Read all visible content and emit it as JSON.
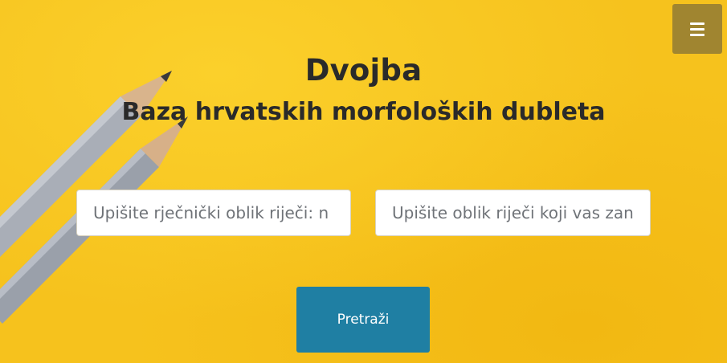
{
  "header": {
    "title": "Dvojba",
    "subtitle": "Baza hrvatskih morfoloških dubleta"
  },
  "menu": {
    "icon": "hamburger-menu-icon"
  },
  "search": {
    "lemma_placeholder": "Upišite rječnički oblik riječi: n",
    "form_placeholder": "Upišite oblik riječi koji vas zan",
    "button_label": "Pretraži"
  },
  "colors": {
    "background": "#f6c21d",
    "menu_button": "#a08530",
    "search_button": "#1f7fa3",
    "heading_text": "#2a2a2a"
  }
}
